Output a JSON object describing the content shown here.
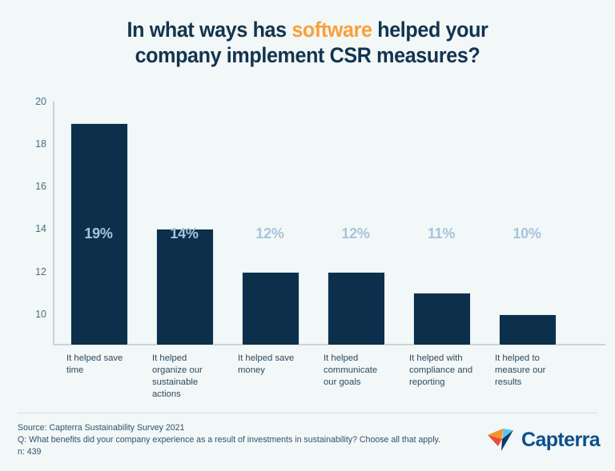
{
  "title": {
    "line1_pre": "In what ways has ",
    "line1_highlight": "software",
    "line1_post": " helped your",
    "line2": "company implement CSR measures?",
    "highlight_color": "#f9a03a",
    "text_color": "#12344f"
  },
  "chart_data": {
    "type": "bar",
    "title": "In what ways has software helped your company implement CSR measures?",
    "categories": [
      "It helped save time",
      "It helped organize our sustainable actions",
      "It helped save money",
      "It helped communicate our goals",
      "It helped with compliance and reporting",
      "It helped to measure our results"
    ],
    "category_lines": [
      [
        "It helped save",
        "time"
      ],
      [
        "It helped",
        "organize our",
        "sustainable",
        "actions"
      ],
      [
        "It helped save",
        "money"
      ],
      [
        "It helped",
        "communicate",
        "our goals"
      ],
      [
        "It helped with",
        "compliance and",
        "reporting"
      ],
      [
        "It helped to",
        "measure our",
        "results"
      ]
    ],
    "values": [
      19,
      14,
      12,
      12,
      11,
      10
    ],
    "data_labels": [
      "19%",
      "14%",
      "12%",
      "12%",
      "11%",
      "10%"
    ],
    "xlabel": "",
    "ylabel": "",
    "ylim": [
      8.6,
      20
    ],
    "yticks": [
      20,
      18,
      16,
      14,
      12,
      10
    ],
    "ytick_labels": [
      "20",
      "18",
      "16",
      "14",
      "12",
      "10"
    ],
    "grid": false,
    "legend": false,
    "bar_color": "#0c304b",
    "data_label_color": "#a8c4dd",
    "axis_label_color": "#4a6f85",
    "background_color": "#f2f7f7"
  },
  "footer": {
    "source": "Source: Capterra Sustainability Survey 2021",
    "question": "Q: What benefits did your company experience as a result of investments in sustainability? Choose all that apply.",
    "n": "n: 439"
  },
  "brand": {
    "name": "Capterra",
    "wordmark_color": "#0c4f8d",
    "mark_colors": {
      "orange": "#f5952a",
      "red": "#e8503a",
      "light_blue": "#5fc4ef",
      "dark_blue": "#0b3c66"
    }
  }
}
